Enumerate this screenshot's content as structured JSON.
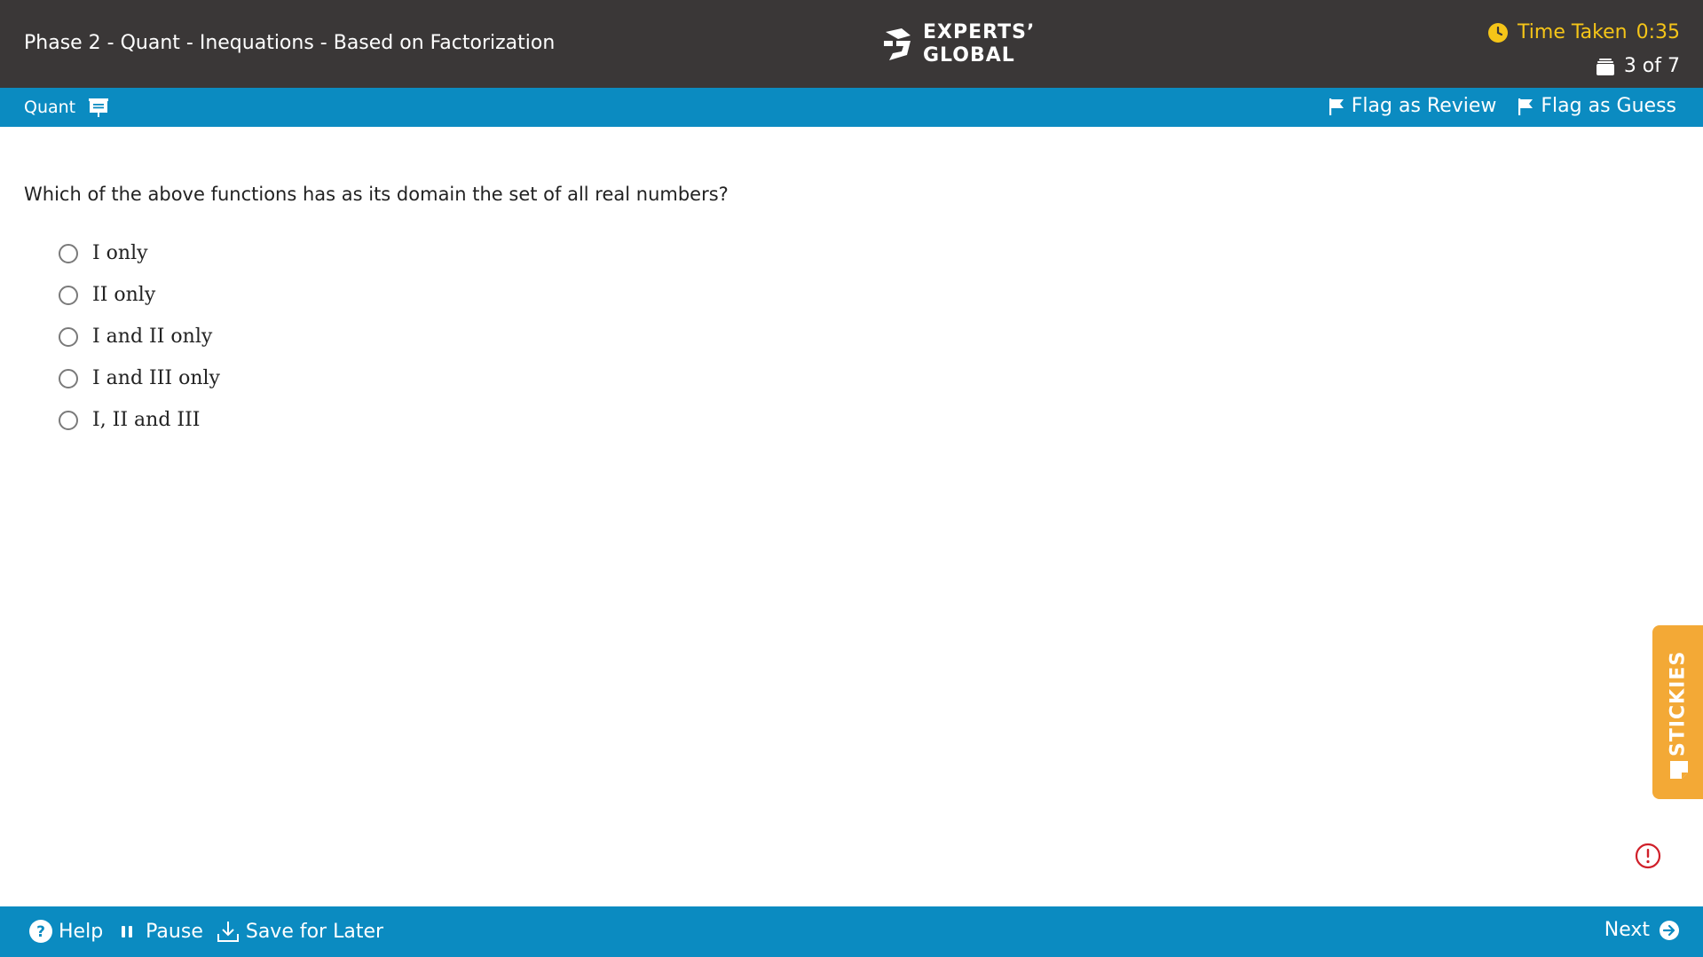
{
  "header": {
    "title": "Phase 2 - Quant - Inequations - Based on Factorization",
    "logo_line1": "EXPERTS’",
    "logo_line2": "GLOBAL",
    "timer_label": "Time Taken",
    "timer_value": "0:35",
    "question_count": "3 of 7"
  },
  "nav": {
    "section_label": "Quant",
    "flag_review": "Flag as Review",
    "flag_guess": "Flag as Guess"
  },
  "question": {
    "text": "Which of the above functions has as its domain the set of all real numbers?",
    "options": [
      "I only",
      "II only",
      "I and II only",
      "I and III only",
      "I, II and III"
    ]
  },
  "stickies": {
    "label": "STICKIES"
  },
  "footer": {
    "help": "Help",
    "pause": "Pause",
    "save": "Save for Later",
    "next": "Next"
  },
  "colors": {
    "header_bg": "#3a3737",
    "accent_blue": "#0b8bc1",
    "timer_yellow": "#f5c518",
    "stickies_orange": "#f3a936",
    "alert_red": "#d0202a"
  }
}
